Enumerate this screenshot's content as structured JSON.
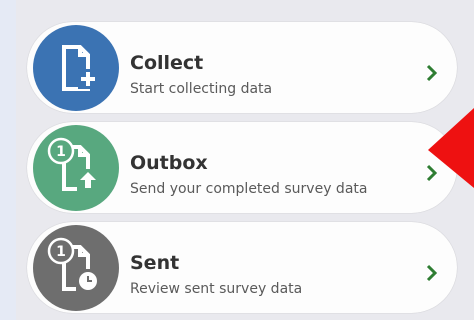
{
  "colors": {
    "collect": "#3b73b3",
    "outbox": "#58a87f",
    "sent": "#6e6e6e",
    "chevron": "#2e7d32",
    "annotation_arrow": "#ee1111"
  },
  "menu": {
    "items": [
      {
        "title": "Collect",
        "subtitle": "Start collecting data",
        "icon": "new-document-icon"
      },
      {
        "title": "Outbox",
        "subtitle": "Send your completed survey data",
        "badge": "1",
        "icon": "upload-document-icon"
      },
      {
        "title": "Sent",
        "subtitle": "Review sent survey data",
        "badge": "1",
        "icon": "sent-document-icon"
      }
    ]
  }
}
